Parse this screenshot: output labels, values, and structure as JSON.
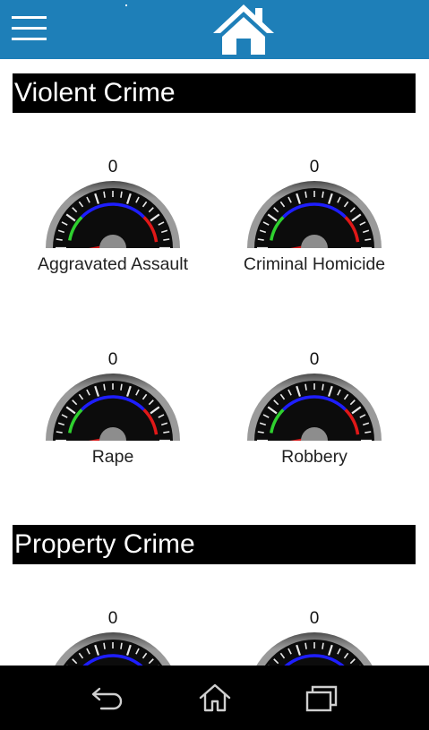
{
  "app_bar": {
    "menu_icon": "hamburger-menu-icon",
    "home_icon": "house-icon",
    "color": "#1e7fb8"
  },
  "sections": [
    {
      "title": "Violent Crime",
      "gauges": [
        {
          "value": "0",
          "label": "Aggravated Assault"
        },
        {
          "value": "0",
          "label": "Criminal Homicide"
        },
        {
          "value": "0",
          "label": "Rape"
        },
        {
          "value": "0",
          "label": "Robbery"
        }
      ]
    },
    {
      "title": "Property Crime",
      "gauges": [
        {
          "value": "0",
          "label": ""
        },
        {
          "value": "0",
          "label": ""
        }
      ]
    }
  ],
  "nav_bar": {
    "back_icon": "back-arrow-icon",
    "home_icon": "home-outline-icon",
    "recents_icon": "recent-apps-icon"
  }
}
